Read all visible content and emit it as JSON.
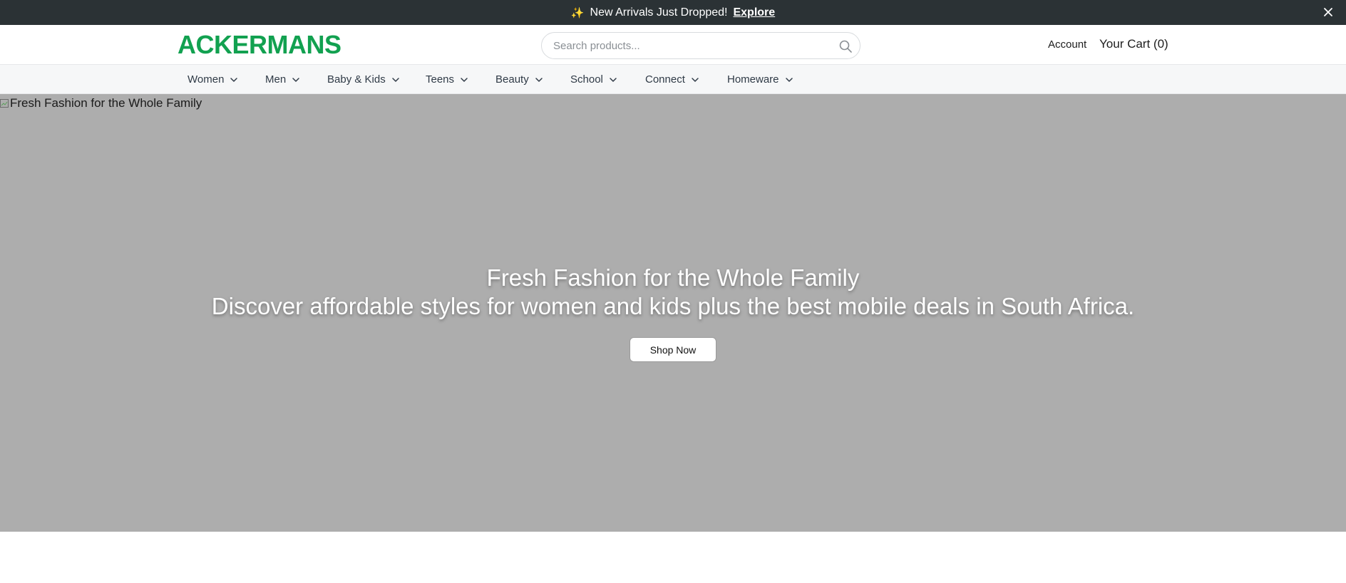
{
  "announcement": {
    "icon": "sparkle-icon",
    "message": "New Arrivals Just Dropped!",
    "link_label": "Explore"
  },
  "header": {
    "logo_text": "ACKERMANS",
    "search_placeholder": "Search products...",
    "account_label": "Account",
    "cart_label": "Your Cart (0)"
  },
  "nav": {
    "items": [
      {
        "label": "Women"
      },
      {
        "label": "Men"
      },
      {
        "label": "Baby & Kids"
      },
      {
        "label": "Teens"
      },
      {
        "label": "Beauty"
      },
      {
        "label": "School"
      },
      {
        "label": "Connect"
      },
      {
        "label": "Homeware"
      }
    ]
  },
  "hero": {
    "image_alt": "Fresh Fashion for the Whole Family",
    "headline": "Fresh Fashion for the Whole Family",
    "subline": "Discover affordable styles for women and kids plus the best mobile deals in South Africa.",
    "cta_label": "Shop Now"
  },
  "colors": {
    "brand_green": "#12a150",
    "announcement_bg": "#2b3235",
    "hero_bg": "#adadad"
  }
}
